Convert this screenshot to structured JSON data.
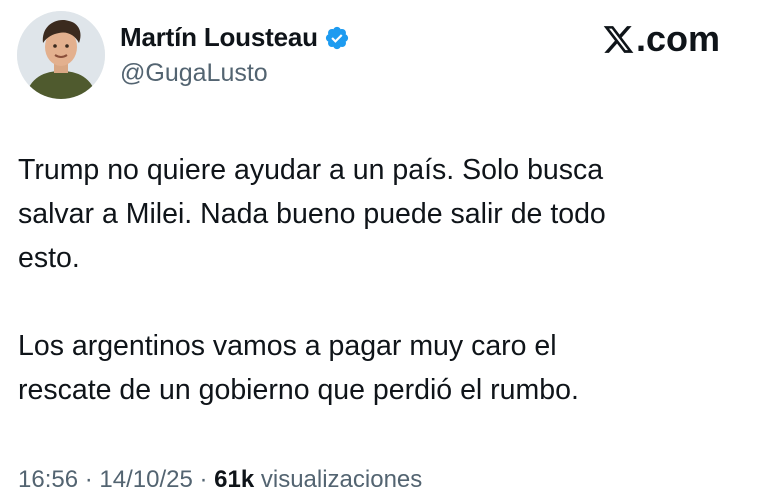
{
  "author": {
    "display_name": "Martín Lousteau",
    "handle": "@GugaLusto",
    "verified_color": "#1d9bf0",
    "avatar": "profile-photo"
  },
  "brand": {
    "icon": "x-logo-icon",
    "label": ".com"
  },
  "tweet": {
    "paragraphs": [
      "Trump no quiere ayudar a un país. Solo busca\nsalvar a Milei. Nada bueno puede salir de todo\nesto.",
      "Los argentinos vamos a pagar muy caro el\nrescate de un gobierno que perdió el rumbo."
    ]
  },
  "meta": {
    "time": "16:56",
    "sep1": " · ",
    "date": "14/10/25",
    "sep2": " · ",
    "views_count": "61k",
    "views_label": " visualizaciones"
  }
}
